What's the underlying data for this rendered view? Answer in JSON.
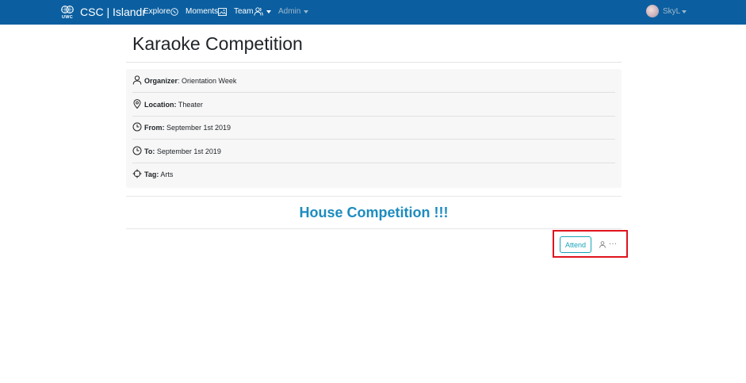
{
  "navbar": {
    "logo_text": "UWC",
    "brand": "CSC | Islandr",
    "items": [
      {
        "label": "Explore",
        "icon": "compass-icon"
      },
      {
        "label": "Moments",
        "icon": "image-icon"
      },
      {
        "label": "Team",
        "icon": "users-icon"
      },
      {
        "label": "Admin"
      }
    ],
    "user": {
      "name": "SkyL"
    }
  },
  "event": {
    "title": "Karaoke Competition",
    "details": [
      {
        "label": "Organizer",
        "value": ": Orientation Week",
        "icon": "user-icon"
      },
      {
        "label": "Location:",
        "value": " Theater",
        "icon": "location-pin-icon"
      },
      {
        "label": "From:",
        "value": " September 1st 2019",
        "icon": "clock-icon"
      },
      {
        "label": "To:",
        "value": " September 1st 2019",
        "icon": "clock-icon"
      },
      {
        "label": "Tag:",
        "value": " Arts",
        "icon": "crosshair-icon"
      }
    ],
    "description_heading": "House Competition !!!",
    "actions": {
      "attend_label": "Attend",
      "more": "···"
    }
  },
  "colors": {
    "navbar": "#0b5fa0",
    "heading": "#1d8cbf",
    "attend": "#1aa4b8",
    "highlight": "#e0141e"
  }
}
